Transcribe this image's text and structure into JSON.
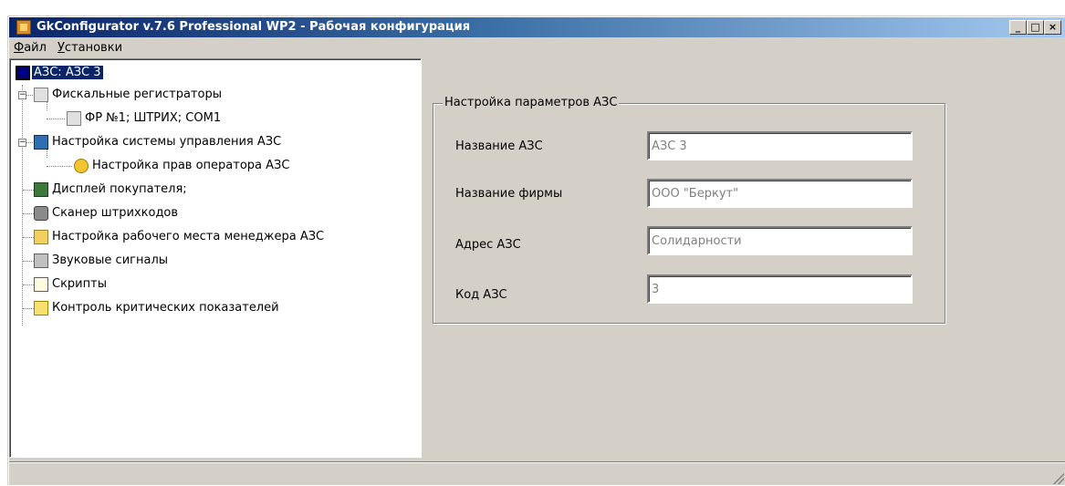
{
  "window": {
    "title": "GkConfigurator v.7.6 Professional WP2 - Рабочая конфигурация",
    "minimize_label": "_",
    "maximize_label": "□",
    "close_label": "×"
  },
  "menu": {
    "file": "Файл",
    "settings": "Установки"
  },
  "tree": {
    "root": "АЗС: АЗС 3",
    "items": [
      {
        "label": "Фискальные регистраторы",
        "icon": "printer-icon"
      },
      {
        "label": "ФР №1; ШТРИХ; COM1",
        "icon": "printer-icon"
      },
      {
        "label": "Настройка системы управления АЗС",
        "icon": "grid-panel-icon"
      },
      {
        "label": "Настройка прав оператора АЗС",
        "icon": "key-icon"
      },
      {
        "label": "Дисплей покупателя;",
        "icon": "display-icon"
      },
      {
        "label": "Сканер штрихкодов",
        "icon": "scanner-icon"
      },
      {
        "label": "Настройка рабочего места менеджера АЗС",
        "icon": "briefcase-icon"
      },
      {
        "label": "Звуковые сигналы",
        "icon": "speaker-icon"
      },
      {
        "label": "Скрипты",
        "icon": "script-icon"
      },
      {
        "label": "Контроль критических показателей",
        "icon": "envelope-alert-icon"
      }
    ]
  },
  "settings_panel": {
    "legend": "Настройка параметров АЗС",
    "fields": [
      {
        "label": "Название АЗС",
        "value": "АЗС 3"
      },
      {
        "label": "Название фирмы",
        "value": "ООО \"Беркут\""
      },
      {
        "label": "Адрес АЗС",
        "value": "Солидарности"
      },
      {
        "label": "Код АЗС",
        "value": "3"
      }
    ]
  }
}
